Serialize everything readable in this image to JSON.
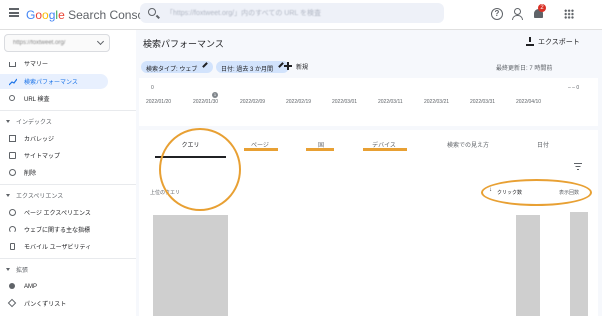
{
  "app": {
    "logo_parts": [
      "G",
      "o",
      "o",
      "g",
      "l",
      "e"
    ],
    "logo_rest": " Search Console",
    "search_placeholder": "「https://foxtweet.org/」内のすべての URL を検査",
    "notification_count": "2"
  },
  "property": {
    "label": "https://foxtweet.org/"
  },
  "sidebar": {
    "items_top": [
      {
        "label": "サマリー",
        "icon": "home-icon"
      },
      {
        "label": "検索パフォーマンス",
        "icon": "trending-icon",
        "active": true
      },
      {
        "label": "URL 検査",
        "icon": "search-icon"
      }
    ],
    "sections": [
      {
        "label": "インデックス",
        "items": [
          {
            "label": "カバレッジ",
            "icon": "coverage-icon"
          },
          {
            "label": "サイトマップ",
            "icon": "sitemap-icon"
          },
          {
            "label": "削除",
            "icon": "remove-icon"
          }
        ]
      },
      {
        "label": "エクスペリエンス",
        "items": [
          {
            "label": "ページ エクスペリエンス",
            "icon": "experience-icon"
          },
          {
            "label": "ウェブに関する主な指標",
            "icon": "vitals-icon"
          },
          {
            "label": "モバイル ユーザビリティ",
            "icon": "mobile-icon"
          }
        ]
      },
      {
        "label": "拡張",
        "items": [
          {
            "label": "AMP",
            "icon": "amp-icon"
          },
          {
            "label": "パンくずリスト",
            "icon": "breadcrumb-icon"
          }
        ]
      }
    ]
  },
  "header": {
    "title": "検索パフォーマンス",
    "export_label": "エクスポート",
    "chips": [
      "検索タイプ: ウェブ",
      "日付: 過去 3 か月間"
    ],
    "new_label": "新規",
    "updated": "最終更新日: 7 時間前"
  },
  "chart": {
    "x_ticks": [
      "2022/01/20",
      "2022/01/30",
      "2022/02/09",
      "2022/02/19",
      "2022/03/01",
      "2022/03/11",
      "2022/03/21",
      "2022/03/31",
      "2022/04/10"
    ],
    "zero_label": "0",
    "annotation": "1"
  },
  "table": {
    "tabs": [
      "クエリ",
      "ページ",
      "国",
      "デバイス",
      "検索での見え方",
      "日付"
    ],
    "active_tab": "クエリ",
    "col_left": "上位のクエリ",
    "col_clicks": "クリック数",
    "col_impressions": "表示回数",
    "sort_arrow": "↓"
  },
  "colors": {
    "accent": "#1a73e8",
    "highlight": "#e8a033",
    "chip": "#d2e3fc"
  }
}
